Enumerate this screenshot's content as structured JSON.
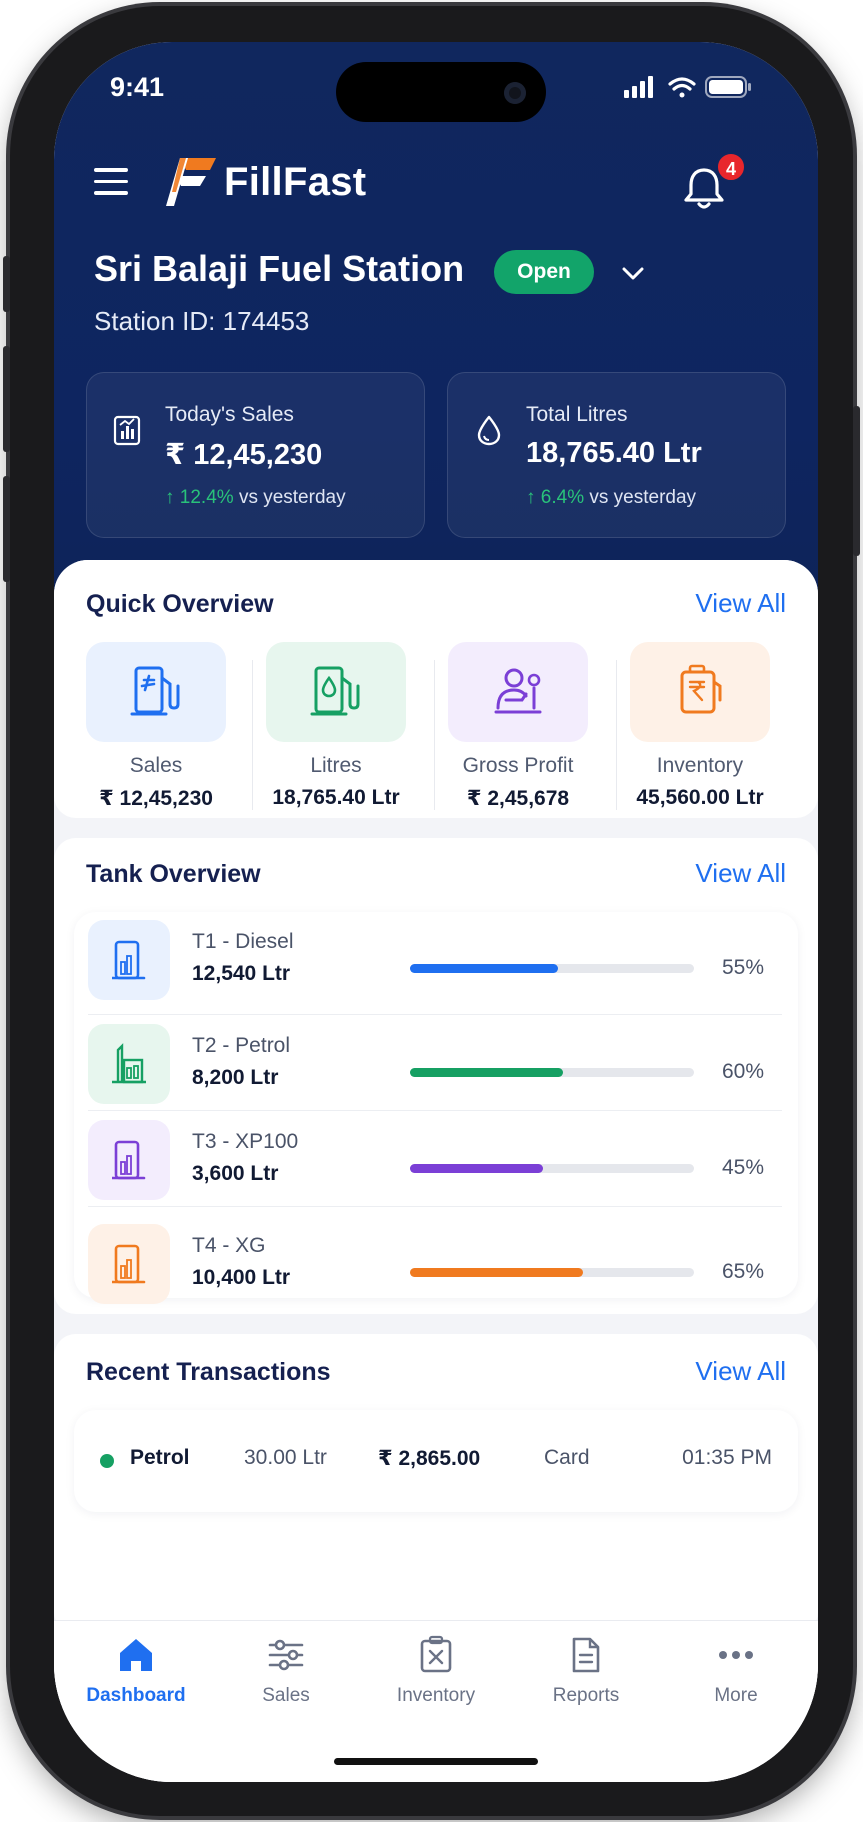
{
  "status_bar": {
    "time": "9:41"
  },
  "app": {
    "brand": "FillFast",
    "notifications_count": "4"
  },
  "station": {
    "name": "Sri Balaji Fuel Station",
    "status": "Open",
    "station_id": "Station ID: 174453"
  },
  "kpis": [
    {
      "label": "Today's Sales",
      "value": "₹ 12,45,230",
      "delta": "↑ 12.4%",
      "delta_suffix": "vs yesterday",
      "icon": "sales-chart-icon"
    },
    {
      "label": "Total Litres",
      "value": "18,765.40 Ltr",
      "delta": "↑ 6.4%",
      "delta_suffix": "vs yesterday",
      "icon": "droplet-icon"
    }
  ],
  "quick_overview": {
    "title": "Quick Overview",
    "view_all": "View All",
    "items": [
      {
        "label": "Sales",
        "value": "₹ 12,45,230",
        "icon": "fuel-pump-icon",
        "color": "#1f6ff0"
      },
      {
        "label": "Litres",
        "value": "18,765.40 Ltr",
        "icon": "fuel-drop-pump-icon",
        "color": "#16a063"
      },
      {
        "label": "Gross Profit",
        "value": "₹ 2,45,678",
        "icon": "profit-person-icon",
        "color": "#7b3fd6"
      },
      {
        "label": "Inventory",
        "value": "45,560.00 Ltr",
        "icon": "inventory-tank-icon",
        "color": "#f07a1f"
      }
    ]
  },
  "tank_overview": {
    "title": "Tank Overview",
    "view_all": "View All",
    "tanks": [
      {
        "name": "T1 - Diesel",
        "volume": "12,540 Ltr",
        "percent_label": "55%",
        "fill": 0.52,
        "color": "#1f6ff0"
      },
      {
        "name": "T2 - Petrol",
        "volume": "8,200 Ltr",
        "percent_label": "60%",
        "fill": 0.54,
        "color": "#16a063"
      },
      {
        "name": "T3 - XP100",
        "volume": "3,600 Ltr",
        "percent_label": "45%",
        "fill": 0.47,
        "color": "#7b3fd6"
      },
      {
        "name": "T4 - XG",
        "volume": "10,400 Ltr",
        "percent_label": "65%",
        "fill": 0.61,
        "color": "#f07a1f"
      }
    ]
  },
  "recent_transactions": {
    "title": "Recent Transactions",
    "view_all": "View All",
    "rows": [
      {
        "fuel": "Petrol",
        "quantity": "30.00 Ltr",
        "amount": "₹ 2,865.00",
        "method": "Card",
        "time": "01:35 PM"
      }
    ]
  },
  "tabbar": {
    "items": [
      {
        "label": "Dashboard",
        "icon": "home-icon",
        "active": true
      },
      {
        "label": "Sales",
        "icon": "sliders-icon"
      },
      {
        "label": "Inventory",
        "icon": "inventory-box-icon"
      },
      {
        "label": "Reports",
        "icon": "document-icon"
      },
      {
        "label": "More",
        "icon": "more-dots-icon"
      }
    ]
  }
}
